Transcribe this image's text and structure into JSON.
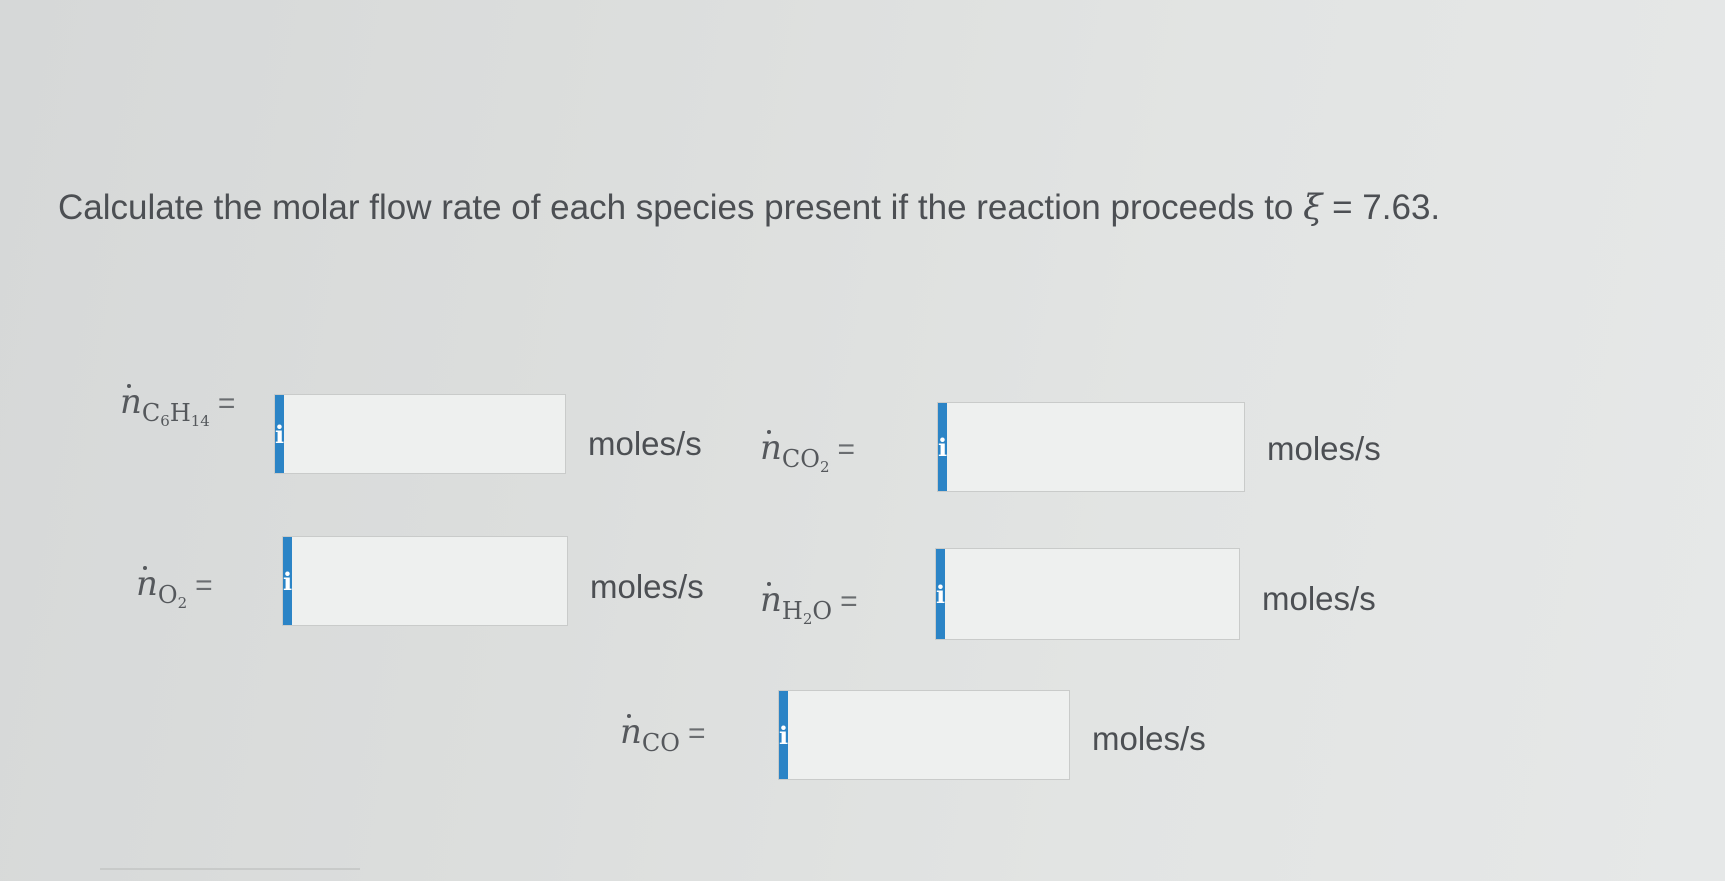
{
  "question": {
    "text_before": "Calculate the molar flow rate of each species present if the reaction proceeds to ",
    "xi_symbol": "ξ",
    "text_after": " = 7.63."
  },
  "fields": [
    {
      "n": "n",
      "species": "C",
      "sub1": "6",
      "species2": "H",
      "sub2": "14",
      "equals": "=",
      "unit": "moles/s",
      "value": ""
    },
    {
      "n": "n",
      "species": "CO",
      "sub1": "2",
      "equals": "=",
      "unit": "moles/s",
      "value": ""
    },
    {
      "n": "n",
      "species": "O",
      "sub1": "2",
      "equals": "=",
      "unit": "moles/s",
      "value": ""
    },
    {
      "n": "n",
      "species": "H",
      "sub1": "2",
      "species2": "O",
      "equals": "=",
      "unit": "moles/s",
      "value": ""
    },
    {
      "n": "n",
      "species": "CO",
      "equals": "=",
      "unit": "moles/s",
      "value": ""
    }
  ],
  "info_button_label": "i",
  "colors": {
    "info_button": "#2b84c6",
    "background": "#dfe1e0",
    "text": "#4c4f53"
  },
  "icons": {
    "info": "info-icon"
  }
}
